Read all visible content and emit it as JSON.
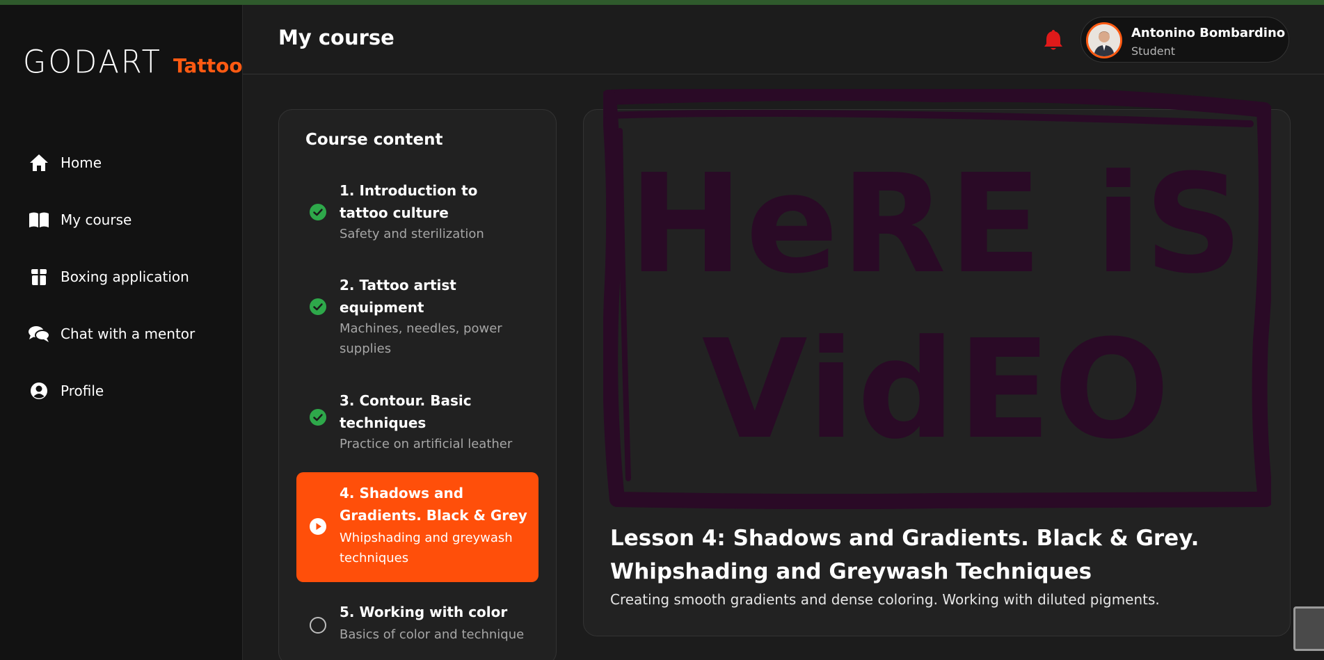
{
  "brand": {
    "left": "GODART",
    "right": "Tattoo"
  },
  "nav": [
    {
      "label": "Home",
      "icon": "home-icon"
    },
    {
      "label": "My course",
      "icon": "book-icon"
    },
    {
      "label": "Boxing application",
      "icon": "box-icon"
    },
    {
      "label": "Chat with a mentor",
      "icon": "chat-icon"
    },
    {
      "label": "Profile",
      "icon": "user-circle-icon"
    }
  ],
  "header": {
    "title": "My course"
  },
  "user": {
    "name": "Antonino Bombardino",
    "role": "Student"
  },
  "course": {
    "title": "Course content",
    "lessons": [
      {
        "title": "1. Introduction to tattoo culture",
        "subtitle": "Safety and sterilization",
        "status": "completed"
      },
      {
        "title": "2. Tattoo artist equipment",
        "subtitle": "Machines, needles, power supplies",
        "status": "completed"
      },
      {
        "title": "3. Contour. Basic techniques",
        "subtitle": "Practice on artificial leather",
        "status": "completed"
      },
      {
        "title": "4. Shadows and Gradients. Black & Grey",
        "subtitle": "Whipshading and greywash techniques",
        "status": "current"
      },
      {
        "title": "5. Working with color",
        "subtitle": "Basics of color and technique",
        "status": "locked"
      }
    ]
  },
  "video": {
    "placeholder_line1": "HeRE iS",
    "placeholder_line2": "VidEO",
    "title": "Lesson 4: Shadows and Gradients. Black & Grey. Whipshading and Greywash Techniques",
    "description": "Creating smooth gradients and dense coloring. Working with diluted pigments."
  },
  "colors": {
    "accent": "#ff4f0a",
    "success": "#2ea84a",
    "bell": "#e01a1a",
    "scribble": "#2a0a26"
  }
}
